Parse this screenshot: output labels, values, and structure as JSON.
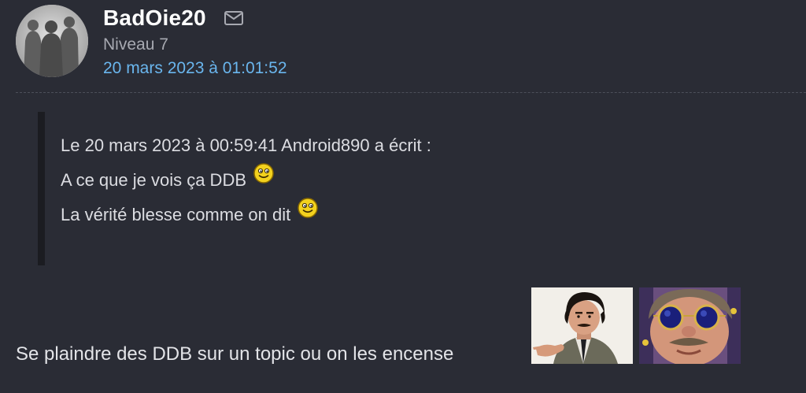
{
  "author": {
    "name": "BadOie20",
    "level": "Niveau 7",
    "date": "20 mars 2023 à 01:01:52",
    "mail_icon": "envelope-icon",
    "avatar_icon": "silhouette-group-avatar"
  },
  "quote": {
    "header": "Le 20 mars 2023 à 00:59:41 Android890 a écrit :",
    "lines": [
      {
        "text": "A ce que je vois ça DDB",
        "smiley": "smiley-icon"
      },
      {
        "text": "La vérité blesse comme on dit",
        "smiley": "smiley-icon"
      }
    ]
  },
  "message": {
    "text": "Se plaindre des DDB sur un topic ou on les encense",
    "stickers": [
      "sticker-man-pointing",
      "sticker-man-sunglasses"
    ]
  },
  "colors": {
    "background": "#2a2c35",
    "author_name": "#ffffff",
    "level": "#a7a9b1",
    "date_link": "#6ab6ee",
    "quote_bar": "#1b1c21",
    "text": "#dcdde2"
  }
}
